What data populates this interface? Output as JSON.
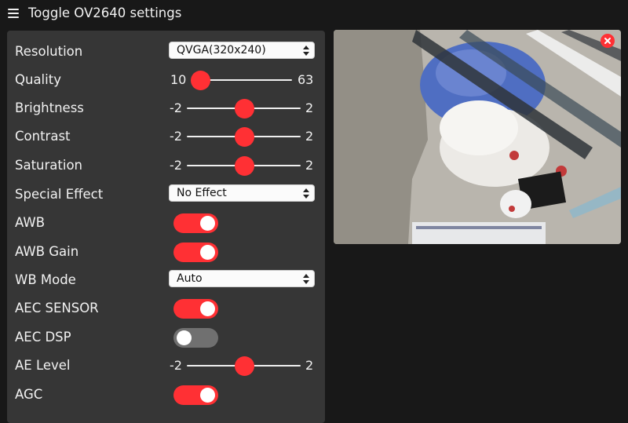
{
  "header": {
    "title": "Toggle OV2640 settings",
    "menu_icon": "hamburger-menu-icon"
  },
  "accent_color": "#ff3034",
  "settings": {
    "resolution": {
      "label": "Resolution",
      "value": "QVGA(320x240)"
    },
    "quality": {
      "label": "Quality",
      "min": "10",
      "max": "63",
      "value": 10
    },
    "brightness": {
      "label": "Brightness",
      "min": "-2",
      "max": "2",
      "value": 0
    },
    "contrast": {
      "label": "Contrast",
      "min": "-2",
      "max": "2",
      "value": 0
    },
    "saturation": {
      "label": "Saturation",
      "min": "-2",
      "max": "2",
      "value": 0
    },
    "special_effect": {
      "label": "Special Effect",
      "value": "No Effect"
    },
    "awb": {
      "label": "AWB",
      "on": true
    },
    "awb_gain": {
      "label": "AWB Gain",
      "on": true
    },
    "wb_mode": {
      "label": "WB Mode",
      "value": "Auto"
    },
    "aec_sensor": {
      "label": "AEC SENSOR",
      "on": true
    },
    "aec_dsp": {
      "label": "AEC DSP",
      "on": false
    },
    "ae_level": {
      "label": "AE Level",
      "min": "-2",
      "max": "2",
      "value": 0
    },
    "agc": {
      "label": "AGC",
      "on": true
    }
  },
  "preview": {
    "close_icon": "close-icon"
  }
}
